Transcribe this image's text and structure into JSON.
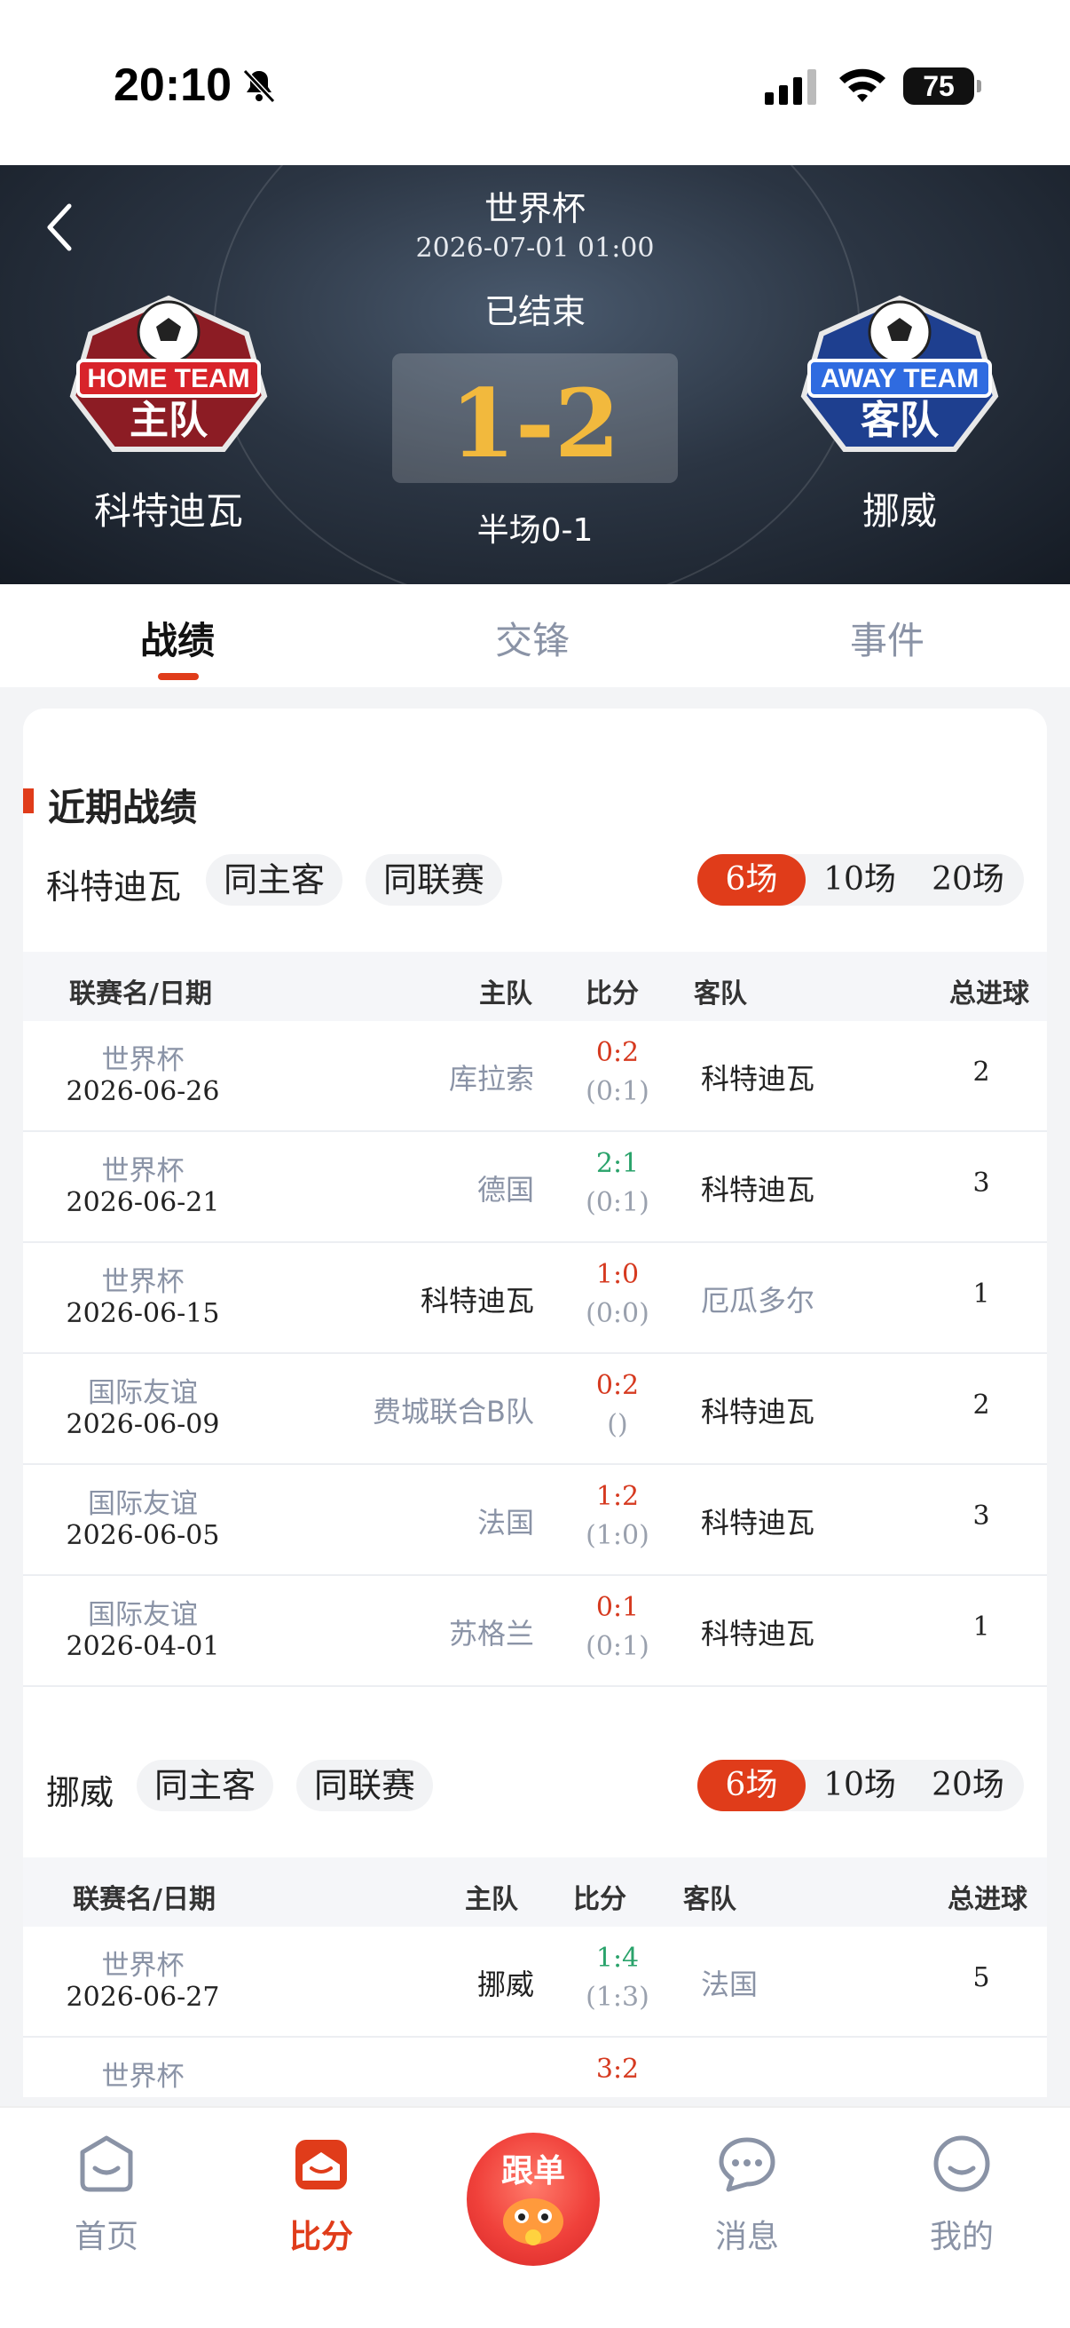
{
  "status_bar": {
    "time": "20:10",
    "battery": "75"
  },
  "match": {
    "league": "世界杯",
    "datetime": "2026-07-01 01:00",
    "state": "已结束",
    "score": "1-2",
    "halftime": "半场0-1",
    "home_team": "科特迪瓦",
    "away_team": "挪威"
  },
  "tabs": [
    {
      "label": "战绩",
      "active": true
    },
    {
      "label": "交锋",
      "active": false
    },
    {
      "label": "事件",
      "active": false
    }
  ],
  "section_title": "近期战绩",
  "columns": {
    "league_date": "联赛名/日期",
    "home": "主队",
    "score": "比分",
    "away": "客队",
    "total": "总进球"
  },
  "home_filter": {
    "team": "科特迪瓦",
    "chip1": "同主客",
    "chip2": "同联赛",
    "options": [
      "6场",
      "10场",
      "20场"
    ],
    "selected": "6场"
  },
  "home_rows": [
    {
      "league": "世界杯",
      "date": "2026-06-26",
      "home": "库拉索",
      "score": "0:2",
      "half": "(0:1)",
      "away": "科特迪瓦",
      "total": "2",
      "result": "red",
      "home_strong": false,
      "away_strong": true
    },
    {
      "league": "世界杯",
      "date": "2026-06-21",
      "home": "德国",
      "score": "2:1",
      "half": "(0:1)",
      "away": "科特迪瓦",
      "total": "3",
      "result": "green",
      "home_strong": false,
      "away_strong": true
    },
    {
      "league": "世界杯",
      "date": "2026-06-15",
      "home": "科特迪瓦",
      "score": "1:0",
      "half": "(0:0)",
      "away": "厄瓜多尔",
      "total": "1",
      "result": "red",
      "home_strong": true,
      "away_strong": false
    },
    {
      "league": "国际友谊",
      "date": "2026-06-09",
      "home": "费城联合B队",
      "score": "0:2",
      "half": "()",
      "away": "科特迪瓦",
      "total": "2",
      "result": "red",
      "home_strong": false,
      "away_strong": true
    },
    {
      "league": "国际友谊",
      "date": "2026-06-05",
      "home": "法国",
      "score": "1:2",
      "half": "(1:0)",
      "away": "科特迪瓦",
      "total": "3",
      "result": "red",
      "home_strong": false,
      "away_strong": true
    },
    {
      "league": "国际友谊",
      "date": "2026-04-01",
      "home": "苏格兰",
      "score": "0:1",
      "half": "(0:1)",
      "away": "科特迪瓦",
      "total": "1",
      "result": "red",
      "home_strong": false,
      "away_strong": true
    }
  ],
  "away_filter": {
    "team": "挪威",
    "chip1": "同主客",
    "chip2": "同联赛",
    "options": [
      "6场",
      "10场",
      "20场"
    ],
    "selected": "6场"
  },
  "away_rows": [
    {
      "league": "世界杯",
      "date": "2026-06-27",
      "home": "挪威",
      "score": "1:4",
      "half": "(1:3)",
      "away": "法国",
      "total": "5",
      "result": "green",
      "home_strong": true,
      "away_strong": false
    },
    {
      "league": "世界杯",
      "date": "",
      "home": "",
      "score": "3:2",
      "half": "",
      "away": "",
      "total": "",
      "result": "red",
      "home_strong": true,
      "away_strong": false
    }
  ],
  "nav": [
    {
      "label": "首页",
      "icon": "home-icon",
      "active": false
    },
    {
      "label": "比分",
      "icon": "score-icon",
      "active": true
    },
    {
      "label": "跟单",
      "icon": "follow-mascot-icon",
      "active": false
    },
    {
      "label": "消息",
      "icon": "message-icon",
      "active": false
    },
    {
      "label": "我的",
      "icon": "profile-icon",
      "active": false
    }
  ],
  "colors": {
    "accent": "#e03c1a",
    "win": "#d63a20",
    "lose": "#2aa36b",
    "score_gold": "#f2b93d"
  }
}
